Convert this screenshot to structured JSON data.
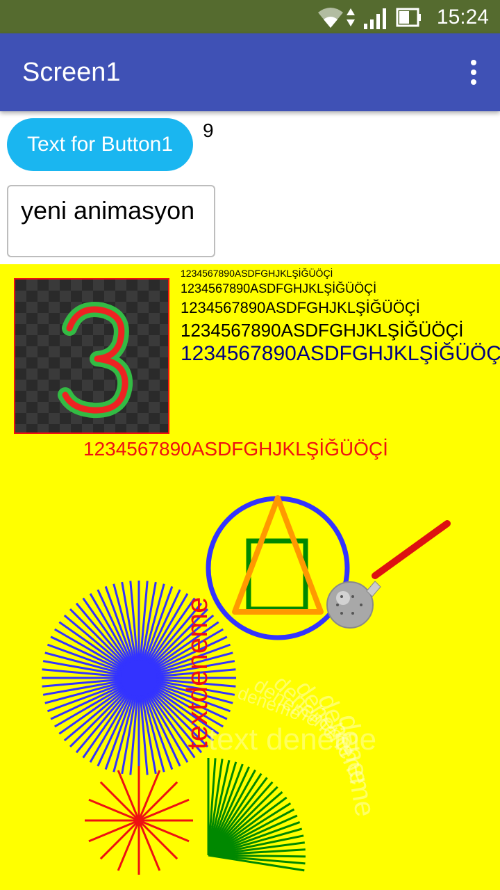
{
  "status_bar": {
    "time": "15:24",
    "icons": [
      "wifi-icon",
      "signal-icon",
      "battery-icon"
    ]
  },
  "app_bar": {
    "title": "Screen1",
    "menu_icon": "more-vert-icon"
  },
  "button1": {
    "label": "Text for Button1",
    "color": "#1ab6f0"
  },
  "counter_label": "9",
  "textbox": {
    "value": "yeni animasyon"
  },
  "canvas": {
    "background": "#ffff00",
    "sprite": {
      "digit": "3"
    },
    "sample_text": "1234567890ASDFGHJKLŞİĞÜÖÇİ",
    "red_text": "1234567890ASDFGHJKLŞİĞÜÖÇİ",
    "vertical_text": "textdeneme",
    "arc_text": "text deneme",
    "rotated_words": [
      "deneme",
      "deneme",
      "deneme",
      "deneme",
      "deneme",
      "deneme"
    ],
    "colors": {
      "blue": "#3333ff",
      "red": "#ee1111",
      "green": "#008800",
      "orange": "#ff9900"
    }
  }
}
